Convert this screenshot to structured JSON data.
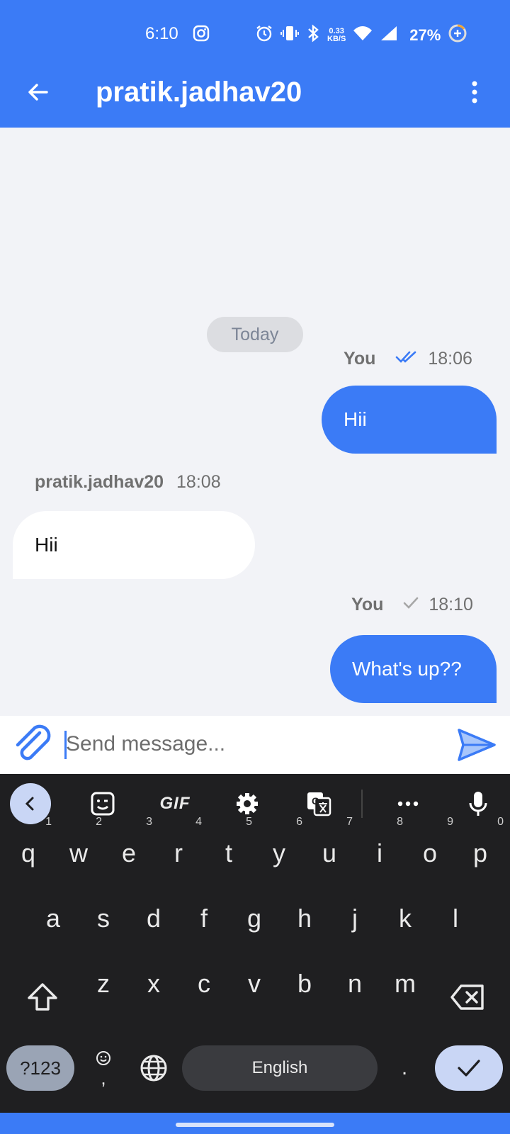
{
  "status_bar": {
    "time": "6:10",
    "net_speed_top": "0.33",
    "net_speed_bottom": "KB/S",
    "battery": "27%",
    "icons": [
      "instagram-icon",
      "alarm-icon",
      "vibrate-icon",
      "bluetooth-icon",
      "wifi-icon",
      "signal-icon",
      "battery-saver-icon"
    ]
  },
  "header": {
    "title": "pratik.jadhav20",
    "back_icon": "arrow-left-icon",
    "menu_icon": "more-vert-icon"
  },
  "chat": {
    "date_label": "Today",
    "messages": [
      {
        "direction": "outgoing",
        "sender": "You",
        "time": "18:06",
        "status": "read",
        "text": "Hii"
      },
      {
        "direction": "incoming",
        "sender": "pratik.jadhav20",
        "time": "18:08",
        "text": "Hii"
      },
      {
        "direction": "outgoing",
        "sender": "You",
        "time": "18:10",
        "status": "sent",
        "text": "What's up??"
      }
    ]
  },
  "composer": {
    "placeholder": "Send message...",
    "value": ""
  },
  "keyboard": {
    "row1": [
      {
        "key": "q",
        "hint": "1"
      },
      {
        "key": "w",
        "hint": "2"
      },
      {
        "key": "e",
        "hint": "3"
      },
      {
        "key": "r",
        "hint": "4"
      },
      {
        "key": "t",
        "hint": "5"
      },
      {
        "key": "y",
        "hint": "6"
      },
      {
        "key": "u",
        "hint": "7"
      },
      {
        "key": "i",
        "hint": "8"
      },
      {
        "key": "o",
        "hint": "9"
      },
      {
        "key": "p",
        "hint": "0"
      }
    ],
    "row2": [
      "a",
      "s",
      "d",
      "f",
      "g",
      "h",
      "j",
      "k",
      "l"
    ],
    "row3": [
      "z",
      "x",
      "c",
      "v",
      "b",
      "n",
      "m"
    ],
    "symbols_label": "?123",
    "emoji_comma": ",",
    "space_label": "English",
    "period_label": ".",
    "toolbar_gif_label": "GIF"
  },
  "colors": {
    "accent": "#3b7bf6",
    "chat_bg": "#f2f3f7",
    "keyboard_bg": "#1f1f21"
  }
}
